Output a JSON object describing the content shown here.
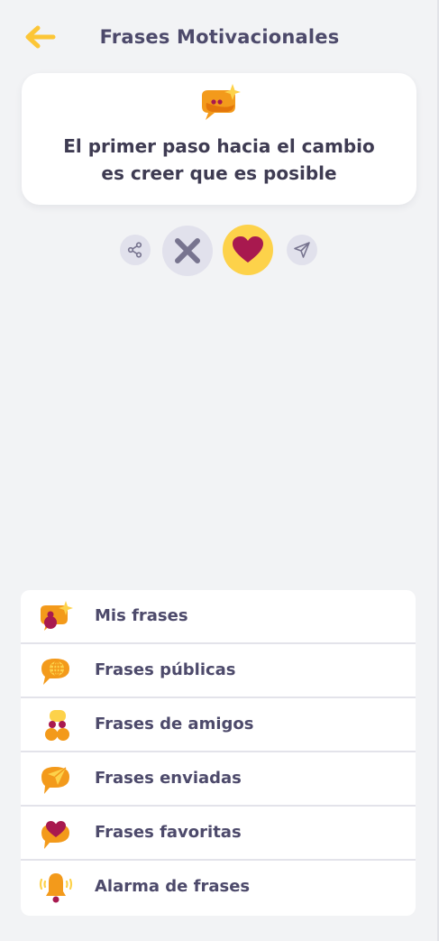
{
  "header": {
    "title": "Frases Motivacionales",
    "back_icon": "arrow-left-icon",
    "accent_color": "#fcc637"
  },
  "quote": {
    "icon": "speech-bubble-sparkle-icon",
    "text": "El primer paso hacia el cambio\nes creer que es posible"
  },
  "actions": {
    "share_icon": "share-icon",
    "dismiss_icon": "close-icon",
    "favorite_icon": "heart-icon",
    "send_icon": "send-icon",
    "heart_color": "#a8194f",
    "favorite_bg": "#fdd24a"
  },
  "menu": {
    "items": [
      {
        "label": "Mis frases",
        "icon": "my-phrases-icon"
      },
      {
        "label": "Frases públicas",
        "icon": "globe-bubble-icon"
      },
      {
        "label": "Frases de amigos",
        "icon": "friends-icon"
      },
      {
        "label": "Frases enviadas",
        "icon": "sent-bubble-icon"
      },
      {
        "label": "Frases favoritas",
        "icon": "heart-bubble-icon"
      },
      {
        "label": "Alarma de frases",
        "icon": "bell-icon"
      }
    ]
  }
}
